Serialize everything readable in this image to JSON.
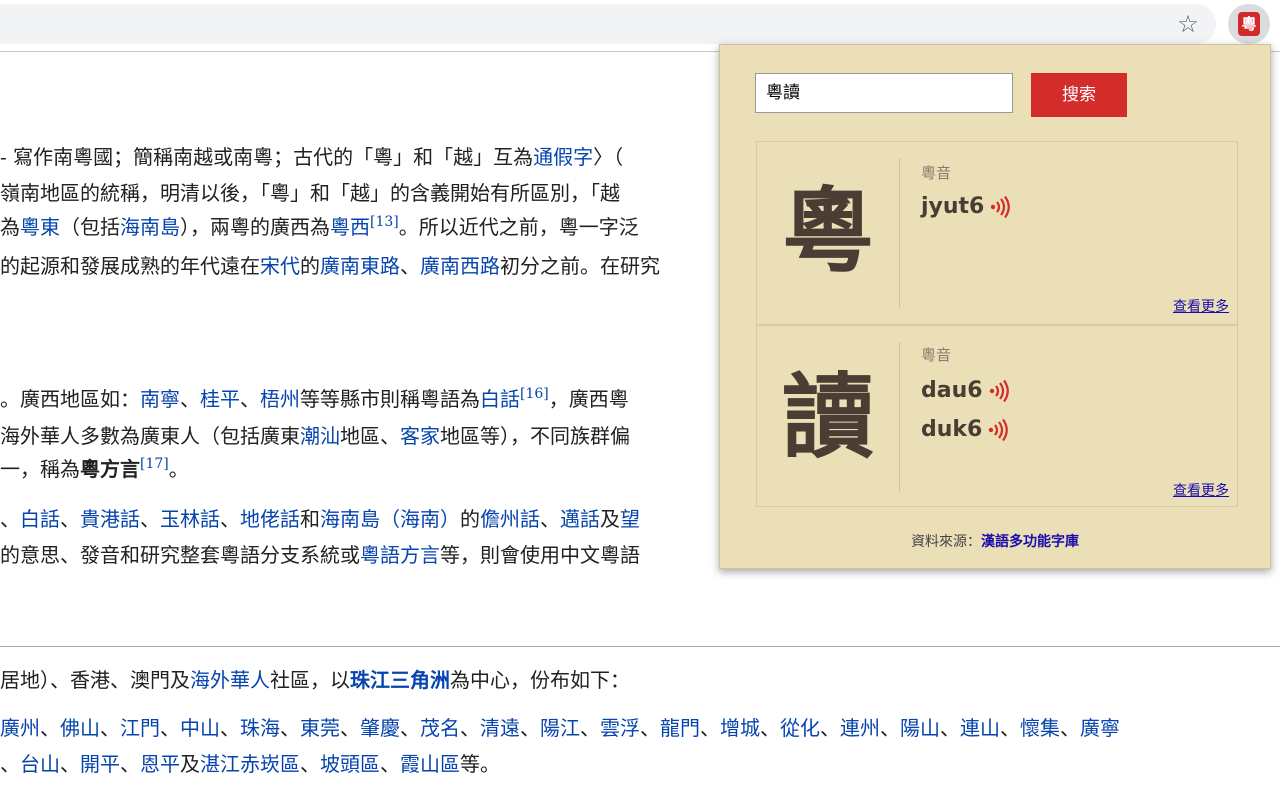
{
  "toolbar": {
    "bookmark_icon": "star-icon",
    "extension_icon_glyph": "粵"
  },
  "article": {
    "lines": [
      [
        {
          "t": "- 寫作南粵國；簡稱南越或南粵；古代的「粵」和「越」互為"
        },
        {
          "t": "通假字",
          "link": true
        },
        {
          "t": "〉（"
        }
      ],
      [
        {
          "t": "嶺南地區的統稱，明清以後，「粵」和「越」的含義開始有所區別，「越"
        }
      ],
      [
        {
          "t": "為"
        },
        {
          "t": "粵東",
          "link": true
        },
        {
          "t": "（包括"
        },
        {
          "t": "海南島",
          "link": true
        },
        {
          "t": "），兩粵的廣西為"
        },
        {
          "t": "粵西",
          "link": true
        },
        {
          "t": "[13]",
          "sup": true
        },
        {
          "t": "。所以近代之前，粵一字泛"
        }
      ],
      [
        {
          "t": "的起源和發展成熟的年代遠在"
        },
        {
          "t": "宋代",
          "link": true
        },
        {
          "t": "的"
        },
        {
          "t": "廣南東路",
          "link": true
        },
        {
          "t": "、"
        },
        {
          "t": "廣南西路",
          "link": true
        },
        {
          "t": "初分之前。在研究"
        }
      ],
      [
        {
          "t": "。廣西地區如："
        },
        {
          "t": "南寧",
          "link": true
        },
        {
          "t": "、"
        },
        {
          "t": "桂平",
          "link": true
        },
        {
          "t": "、"
        },
        {
          "t": "梧州",
          "link": true
        },
        {
          "t": "等等縣市則稱粵語為"
        },
        {
          "t": "白話",
          "link": true
        },
        {
          "t": "[16]",
          "sup": true
        },
        {
          "t": "，廣西粵"
        }
      ],
      [
        {
          "t": "海外華人多數為廣東人（包括廣東"
        },
        {
          "t": "潮汕",
          "link": true
        },
        {
          "t": "地區、"
        },
        {
          "t": "客家",
          "link": true
        },
        {
          "t": "地區等），不同族群偏"
        }
      ],
      [
        {
          "t": "一，稱為"
        },
        {
          "t": "粵方言",
          "bold": true
        },
        {
          "t": "[17]",
          "sup": true
        },
        {
          "t": "。"
        }
      ],
      [
        {
          "t": "、"
        },
        {
          "t": "白話",
          "link": true
        },
        {
          "t": "、"
        },
        {
          "t": "貴港話",
          "link": true
        },
        {
          "t": "、"
        },
        {
          "t": "玉林話",
          "link": true
        },
        {
          "t": "、"
        },
        {
          "t": "地佬話",
          "link": true
        },
        {
          "t": "和"
        },
        {
          "t": "海南島（海南）",
          "link": true
        },
        {
          "t": "的"
        },
        {
          "t": "儋州話",
          "link": true
        },
        {
          "t": "、"
        },
        {
          "t": "邁話",
          "link": true
        },
        {
          "t": "及"
        },
        {
          "t": "望",
          "link": true
        }
      ],
      [
        {
          "t": "的意思、發音和研究整套粵語分支系統或"
        },
        {
          "t": "粵語方言",
          "link": true
        },
        {
          "t": "等，則會使用中文粵語"
        }
      ],
      [
        {
          "t": "居地）、香港、澳門及"
        },
        {
          "t": "海外華人",
          "link": true
        },
        {
          "t": "社區，以"
        },
        {
          "t": "珠江三角洲",
          "link": true,
          "bold": true
        },
        {
          "t": "為中心，份布如下："
        }
      ],
      [
        {
          "t": "廣州",
          "link": true
        },
        {
          "t": "、"
        },
        {
          "t": "佛山",
          "link": true
        },
        {
          "t": "、"
        },
        {
          "t": "江門",
          "link": true
        },
        {
          "t": "、"
        },
        {
          "t": "中山",
          "link": true
        },
        {
          "t": "、"
        },
        {
          "t": "珠海",
          "link": true
        },
        {
          "t": "、"
        },
        {
          "t": "東莞",
          "link": true
        },
        {
          "t": "、"
        },
        {
          "t": "肇慶",
          "link": true
        },
        {
          "t": "、"
        },
        {
          "t": "茂名",
          "link": true
        },
        {
          "t": "、"
        },
        {
          "t": "清遠",
          "link": true
        },
        {
          "t": "、"
        },
        {
          "t": "陽江",
          "link": true
        },
        {
          "t": "、"
        },
        {
          "t": "雲浮",
          "link": true
        },
        {
          "t": "、"
        },
        {
          "t": "龍門",
          "link": true
        },
        {
          "t": "、"
        },
        {
          "t": "增城",
          "link": true
        },
        {
          "t": "、"
        },
        {
          "t": "從化",
          "link": true
        },
        {
          "t": "、"
        },
        {
          "t": "連州",
          "link": true
        },
        {
          "t": "、"
        },
        {
          "t": "陽山",
          "link": true
        },
        {
          "t": "、"
        },
        {
          "t": "連山",
          "link": true
        },
        {
          "t": "、"
        },
        {
          "t": "懷集",
          "link": true
        },
        {
          "t": "、"
        },
        {
          "t": "廣寧",
          "link": true
        }
      ],
      [
        {
          "t": "、"
        },
        {
          "t": "台山",
          "link": true
        },
        {
          "t": "、"
        },
        {
          "t": "開平",
          "link": true
        },
        {
          "t": "、"
        },
        {
          "t": "恩平",
          "link": true
        },
        {
          "t": "及"
        },
        {
          "t": "湛江赤崁區",
          "link": true
        },
        {
          "t": "、"
        },
        {
          "t": "坡頭區",
          "link": true
        },
        {
          "t": "、"
        },
        {
          "t": "霞山區",
          "link": true
        },
        {
          "t": "等。"
        }
      ]
    ]
  },
  "popup": {
    "search_value": "粵讀",
    "search_button": "搜索",
    "cards": [
      {
        "character": "粵",
        "label": "粵音",
        "readings": [
          "jyut6"
        ],
        "more_link": "查看更多"
      },
      {
        "character": "讀",
        "label": "粵音",
        "readings": [
          "dau6",
          "duk6"
        ],
        "more_link": "查看更多"
      }
    ],
    "source_prefix": "資料來源：",
    "source_link": "漢語多功能字庫"
  },
  "colors": {
    "popup_bg": "#ebdfb8",
    "search_button_bg": "#d42b2b",
    "link": "#0645ad",
    "speaker": "#d42b2b"
  }
}
